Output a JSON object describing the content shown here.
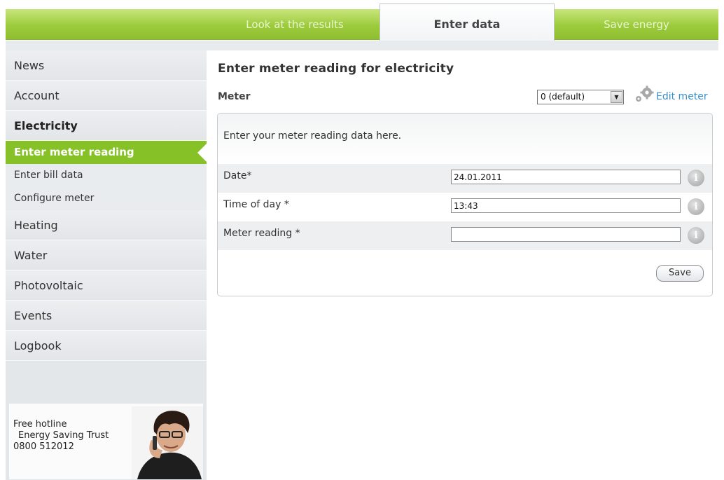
{
  "tabs": [
    {
      "label": "Look at the results"
    },
    {
      "label": "Enter data"
    },
    {
      "label": "Save energy"
    }
  ],
  "sidebar": {
    "items": [
      {
        "label": "News"
      },
      {
        "label": "Account"
      },
      {
        "label": "Electricity"
      },
      {
        "label": "Enter meter reading"
      },
      {
        "label": "Enter bill data"
      },
      {
        "label": "Configure meter"
      },
      {
        "label": "Heating"
      },
      {
        "label": "Water"
      },
      {
        "label": "Photovoltaic"
      },
      {
        "label": "Events"
      },
      {
        "label": "Logbook"
      }
    ],
    "hotline": {
      "line1": "Free hotline",
      "line2": "Energy Saving Trust",
      "line3": "0800 512012"
    }
  },
  "main": {
    "title": "Enter meter reading for electricity",
    "meter_label": "Meter",
    "meter_select_value": "0 (default)",
    "edit_meter_label": "Edit meter",
    "intro": "Enter your meter reading data here.",
    "fields": [
      {
        "label": "Date*",
        "value": "24.01.2011"
      },
      {
        "label": "Time of day *",
        "value": "13:43"
      },
      {
        "label": "Meter reading *",
        "value": ""
      }
    ],
    "save_label": "Save"
  },
  "colors": {
    "accent_green": "#86c128",
    "link_blue": "#3a8fc9"
  }
}
